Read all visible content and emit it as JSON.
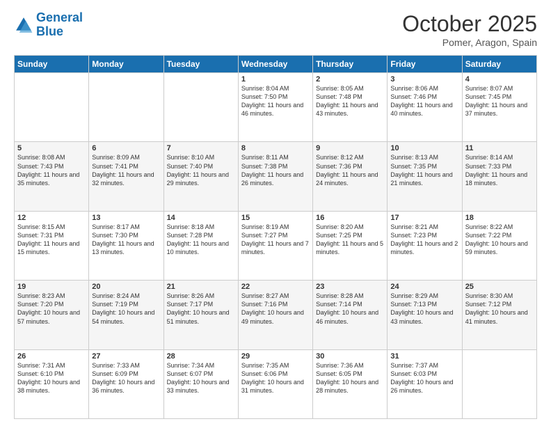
{
  "header": {
    "logo_general": "General",
    "logo_blue": "Blue",
    "month_title": "October 2025",
    "location": "Pomer, Aragon, Spain"
  },
  "days_of_week": [
    "Sunday",
    "Monday",
    "Tuesday",
    "Wednesday",
    "Thursday",
    "Friday",
    "Saturday"
  ],
  "weeks": [
    [
      {
        "day": "",
        "sunrise": "",
        "sunset": "",
        "daylight": ""
      },
      {
        "day": "",
        "sunrise": "",
        "sunset": "",
        "daylight": ""
      },
      {
        "day": "",
        "sunrise": "",
        "sunset": "",
        "daylight": ""
      },
      {
        "day": "1",
        "sunrise": "Sunrise: 8:04 AM",
        "sunset": "Sunset: 7:50 PM",
        "daylight": "Daylight: 11 hours and 46 minutes."
      },
      {
        "day": "2",
        "sunrise": "Sunrise: 8:05 AM",
        "sunset": "Sunset: 7:48 PM",
        "daylight": "Daylight: 11 hours and 43 minutes."
      },
      {
        "day": "3",
        "sunrise": "Sunrise: 8:06 AM",
        "sunset": "Sunset: 7:46 PM",
        "daylight": "Daylight: 11 hours and 40 minutes."
      },
      {
        "day": "4",
        "sunrise": "Sunrise: 8:07 AM",
        "sunset": "Sunset: 7:45 PM",
        "daylight": "Daylight: 11 hours and 37 minutes."
      }
    ],
    [
      {
        "day": "5",
        "sunrise": "Sunrise: 8:08 AM",
        "sunset": "Sunset: 7:43 PM",
        "daylight": "Daylight: 11 hours and 35 minutes."
      },
      {
        "day": "6",
        "sunrise": "Sunrise: 8:09 AM",
        "sunset": "Sunset: 7:41 PM",
        "daylight": "Daylight: 11 hours and 32 minutes."
      },
      {
        "day": "7",
        "sunrise": "Sunrise: 8:10 AM",
        "sunset": "Sunset: 7:40 PM",
        "daylight": "Daylight: 11 hours and 29 minutes."
      },
      {
        "day": "8",
        "sunrise": "Sunrise: 8:11 AM",
        "sunset": "Sunset: 7:38 PM",
        "daylight": "Daylight: 11 hours and 26 minutes."
      },
      {
        "day": "9",
        "sunrise": "Sunrise: 8:12 AM",
        "sunset": "Sunset: 7:36 PM",
        "daylight": "Daylight: 11 hours and 24 minutes."
      },
      {
        "day": "10",
        "sunrise": "Sunrise: 8:13 AM",
        "sunset": "Sunset: 7:35 PM",
        "daylight": "Daylight: 11 hours and 21 minutes."
      },
      {
        "day": "11",
        "sunrise": "Sunrise: 8:14 AM",
        "sunset": "Sunset: 7:33 PM",
        "daylight": "Daylight: 11 hours and 18 minutes."
      }
    ],
    [
      {
        "day": "12",
        "sunrise": "Sunrise: 8:15 AM",
        "sunset": "Sunset: 7:31 PM",
        "daylight": "Daylight: 11 hours and 15 minutes."
      },
      {
        "day": "13",
        "sunrise": "Sunrise: 8:17 AM",
        "sunset": "Sunset: 7:30 PM",
        "daylight": "Daylight: 11 hours and 13 minutes."
      },
      {
        "day": "14",
        "sunrise": "Sunrise: 8:18 AM",
        "sunset": "Sunset: 7:28 PM",
        "daylight": "Daylight: 11 hours and 10 minutes."
      },
      {
        "day": "15",
        "sunrise": "Sunrise: 8:19 AM",
        "sunset": "Sunset: 7:27 PM",
        "daylight": "Daylight: 11 hours and 7 minutes."
      },
      {
        "day": "16",
        "sunrise": "Sunrise: 8:20 AM",
        "sunset": "Sunset: 7:25 PM",
        "daylight": "Daylight: 11 hours and 5 minutes."
      },
      {
        "day": "17",
        "sunrise": "Sunrise: 8:21 AM",
        "sunset": "Sunset: 7:23 PM",
        "daylight": "Daylight: 11 hours and 2 minutes."
      },
      {
        "day": "18",
        "sunrise": "Sunrise: 8:22 AM",
        "sunset": "Sunset: 7:22 PM",
        "daylight": "Daylight: 10 hours and 59 minutes."
      }
    ],
    [
      {
        "day": "19",
        "sunrise": "Sunrise: 8:23 AM",
        "sunset": "Sunset: 7:20 PM",
        "daylight": "Daylight: 10 hours and 57 minutes."
      },
      {
        "day": "20",
        "sunrise": "Sunrise: 8:24 AM",
        "sunset": "Sunset: 7:19 PM",
        "daylight": "Daylight: 10 hours and 54 minutes."
      },
      {
        "day": "21",
        "sunrise": "Sunrise: 8:26 AM",
        "sunset": "Sunset: 7:17 PM",
        "daylight": "Daylight: 10 hours and 51 minutes."
      },
      {
        "day": "22",
        "sunrise": "Sunrise: 8:27 AM",
        "sunset": "Sunset: 7:16 PM",
        "daylight": "Daylight: 10 hours and 49 minutes."
      },
      {
        "day": "23",
        "sunrise": "Sunrise: 8:28 AM",
        "sunset": "Sunset: 7:14 PM",
        "daylight": "Daylight: 10 hours and 46 minutes."
      },
      {
        "day": "24",
        "sunrise": "Sunrise: 8:29 AM",
        "sunset": "Sunset: 7:13 PM",
        "daylight": "Daylight: 10 hours and 43 minutes."
      },
      {
        "day": "25",
        "sunrise": "Sunrise: 8:30 AM",
        "sunset": "Sunset: 7:12 PM",
        "daylight": "Daylight: 10 hours and 41 minutes."
      }
    ],
    [
      {
        "day": "26",
        "sunrise": "Sunrise: 7:31 AM",
        "sunset": "Sunset: 6:10 PM",
        "daylight": "Daylight: 10 hours and 38 minutes."
      },
      {
        "day": "27",
        "sunrise": "Sunrise: 7:33 AM",
        "sunset": "Sunset: 6:09 PM",
        "daylight": "Daylight: 10 hours and 36 minutes."
      },
      {
        "day": "28",
        "sunrise": "Sunrise: 7:34 AM",
        "sunset": "Sunset: 6:07 PM",
        "daylight": "Daylight: 10 hours and 33 minutes."
      },
      {
        "day": "29",
        "sunrise": "Sunrise: 7:35 AM",
        "sunset": "Sunset: 6:06 PM",
        "daylight": "Daylight: 10 hours and 31 minutes."
      },
      {
        "day": "30",
        "sunrise": "Sunrise: 7:36 AM",
        "sunset": "Sunset: 6:05 PM",
        "daylight": "Daylight: 10 hours and 28 minutes."
      },
      {
        "day": "31",
        "sunrise": "Sunrise: 7:37 AM",
        "sunset": "Sunset: 6:03 PM",
        "daylight": "Daylight: 10 hours and 26 minutes."
      },
      {
        "day": "",
        "sunrise": "",
        "sunset": "",
        "daylight": ""
      }
    ]
  ]
}
